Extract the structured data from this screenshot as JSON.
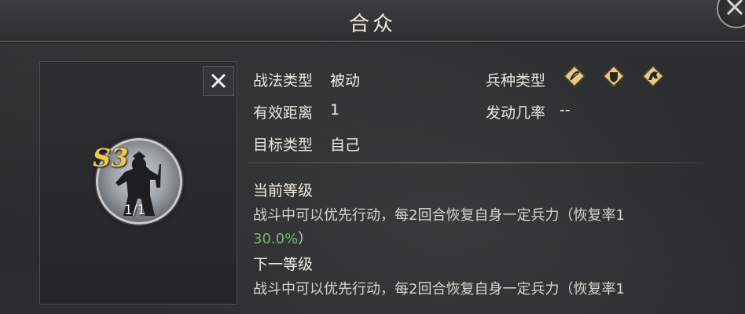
{
  "header": {
    "title": "合众"
  },
  "skill": {
    "grade": "S3",
    "count": "1/1"
  },
  "info": {
    "tactic_type_label": "战法类型",
    "tactic_type_value": "被动",
    "range_label": "有效距离",
    "range_value": "1",
    "target_label": "目标类型",
    "target_value": "自己",
    "troop_label": "兵种类型",
    "troop_icons": [
      "archer-icon",
      "shield-icon",
      "cavalry-icon"
    ],
    "trigger_label": "发动几率",
    "trigger_value": "--"
  },
  "levels": {
    "current_title": "当前等级",
    "current_line1": "战斗中可以优先行动，每2回合恢复自身一定兵力（恢复率1",
    "current_rate": "30.0%",
    "current_close": "）",
    "next_title": "下一等级",
    "next_line1": "战斗中可以优先行动，每2回合恢复自身一定兵力（恢复率1"
  },
  "colors": {
    "accent_gold": "#f2c452",
    "green_text": "#7fb47a",
    "border_gold": "#8a7a58"
  }
}
